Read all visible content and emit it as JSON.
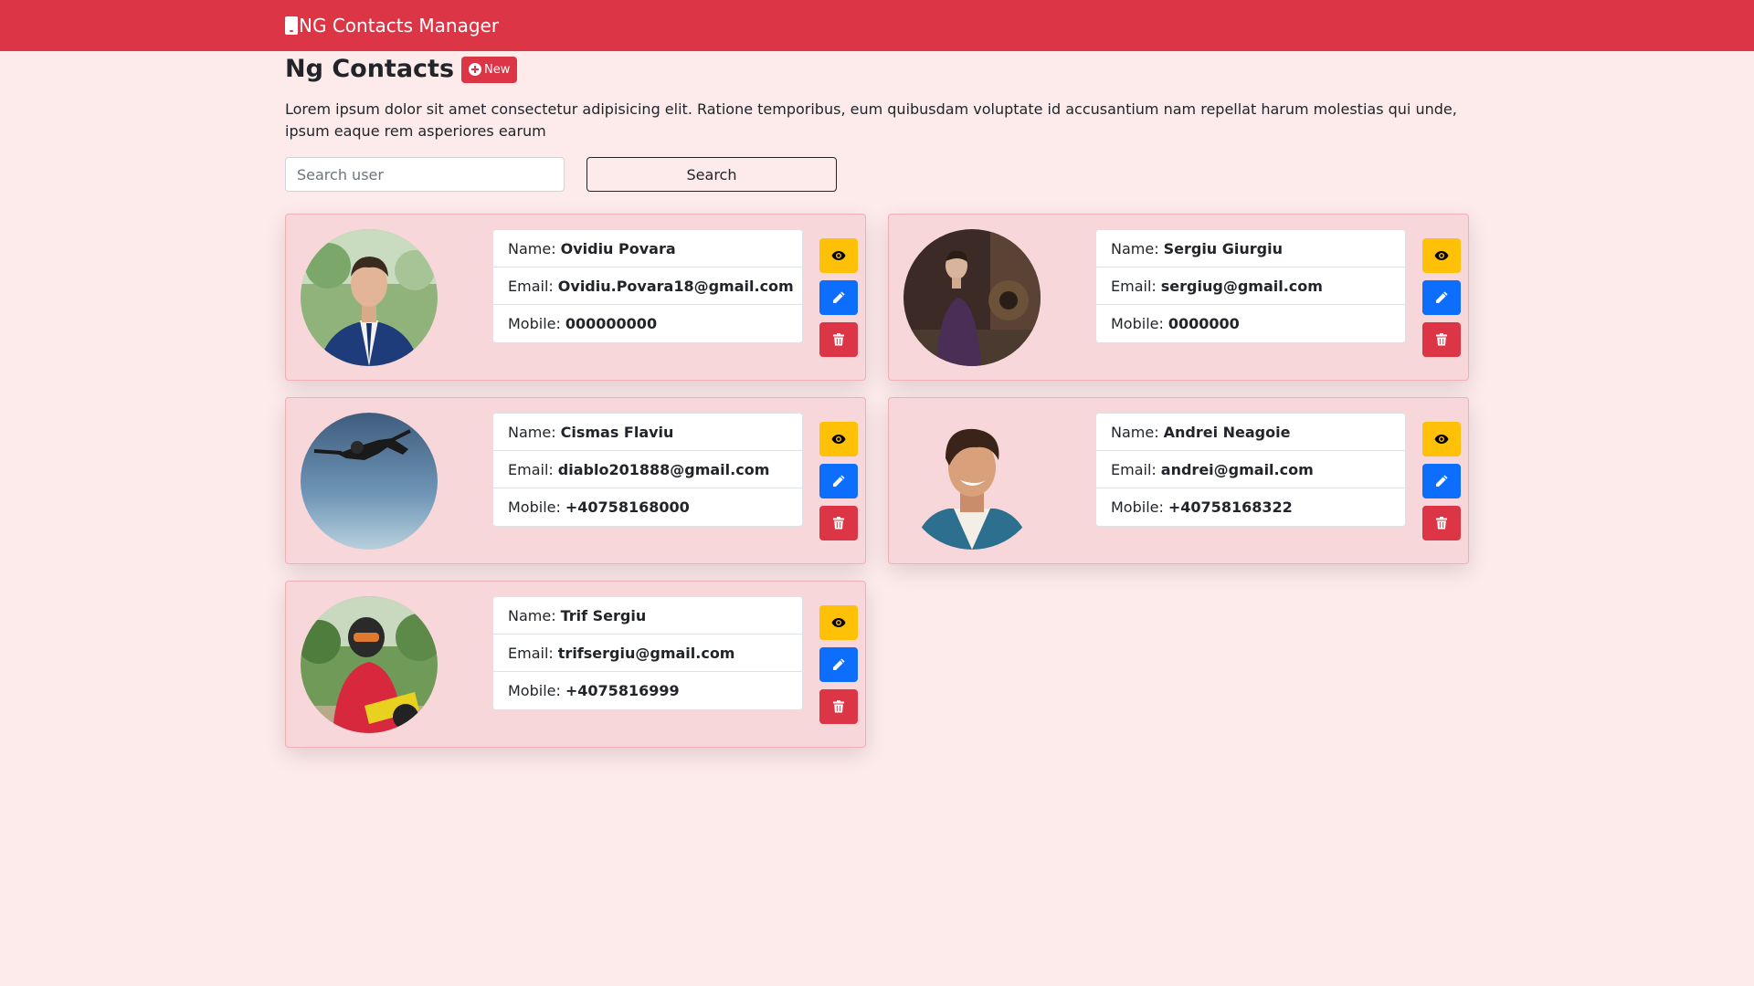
{
  "navbar": {
    "brand": "NG Contacts Manager",
    "brand_icon": "mobile-phone-icon",
    "color": "#dc3545"
  },
  "header": {
    "title": "Ng Contacts",
    "new_label": "New",
    "intro": "Lorem ipsum dolor sit amet consectetur adipisicing elit. Ratione temporibus, eum quibusdam voluptate id accusantium nam repellat harum molestias qui unde, ipsum eaque rem asperiores earum"
  },
  "search": {
    "placeholder": "Search user",
    "value": "",
    "button_label": "Search"
  },
  "labels": {
    "name": "Name:",
    "email": "Email:",
    "mobile": "Mobile:"
  },
  "contacts": [
    {
      "name": "Ovidiu Povara",
      "email": "Ovidiu.Povara18@gmail.com",
      "mobile": "000000000"
    },
    {
      "name": "Sergiu Giurgiu",
      "email": "sergiug@gmail.com",
      "mobile": "0000000"
    },
    {
      "name": "Cismas Flaviu",
      "email": "diablo201888@gmail.com",
      "mobile": "+40758168000"
    },
    {
      "name": "Andrei Neagoie",
      "email": "andrei@gmail.com",
      "mobile": "+40758168322"
    },
    {
      "name": "Trif Sergiu",
      "email": "trifsergiu@gmail.com",
      "mobile": "+4075816999"
    }
  ],
  "colors": {
    "background": "#fdeaea",
    "card": "#f8d7da",
    "view": "#ffc107",
    "edit": "#0d6efd",
    "delete": "#dc3545"
  }
}
